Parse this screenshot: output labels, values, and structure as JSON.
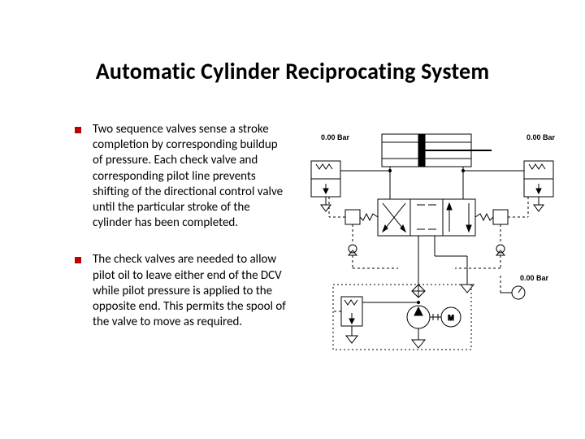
{
  "title": "Automatic Cylinder Reciprocating System",
  "bullets": [
    "Two sequence valves sense a stroke completion by corresponding buildup of pressure.  Each check valve and corresponding  pilot line prevents shifting of the directional control valve until the particular stroke of the cylinder has been completed.",
    "The check valves are needed to allow pilot oil to leave either end of the DCV while pilot pressure is applied to the opposite end.  This permits the spool of the valve to move as required."
  ],
  "diagram": {
    "pressure_top_left": "0.00 Bar",
    "pressure_right": "0.00 Bar",
    "pressure_bottom_right": "0.00 Bar"
  },
  "colors": {
    "bullet": "#c00000",
    "text": "#000000",
    "bg": "#ffffff"
  }
}
